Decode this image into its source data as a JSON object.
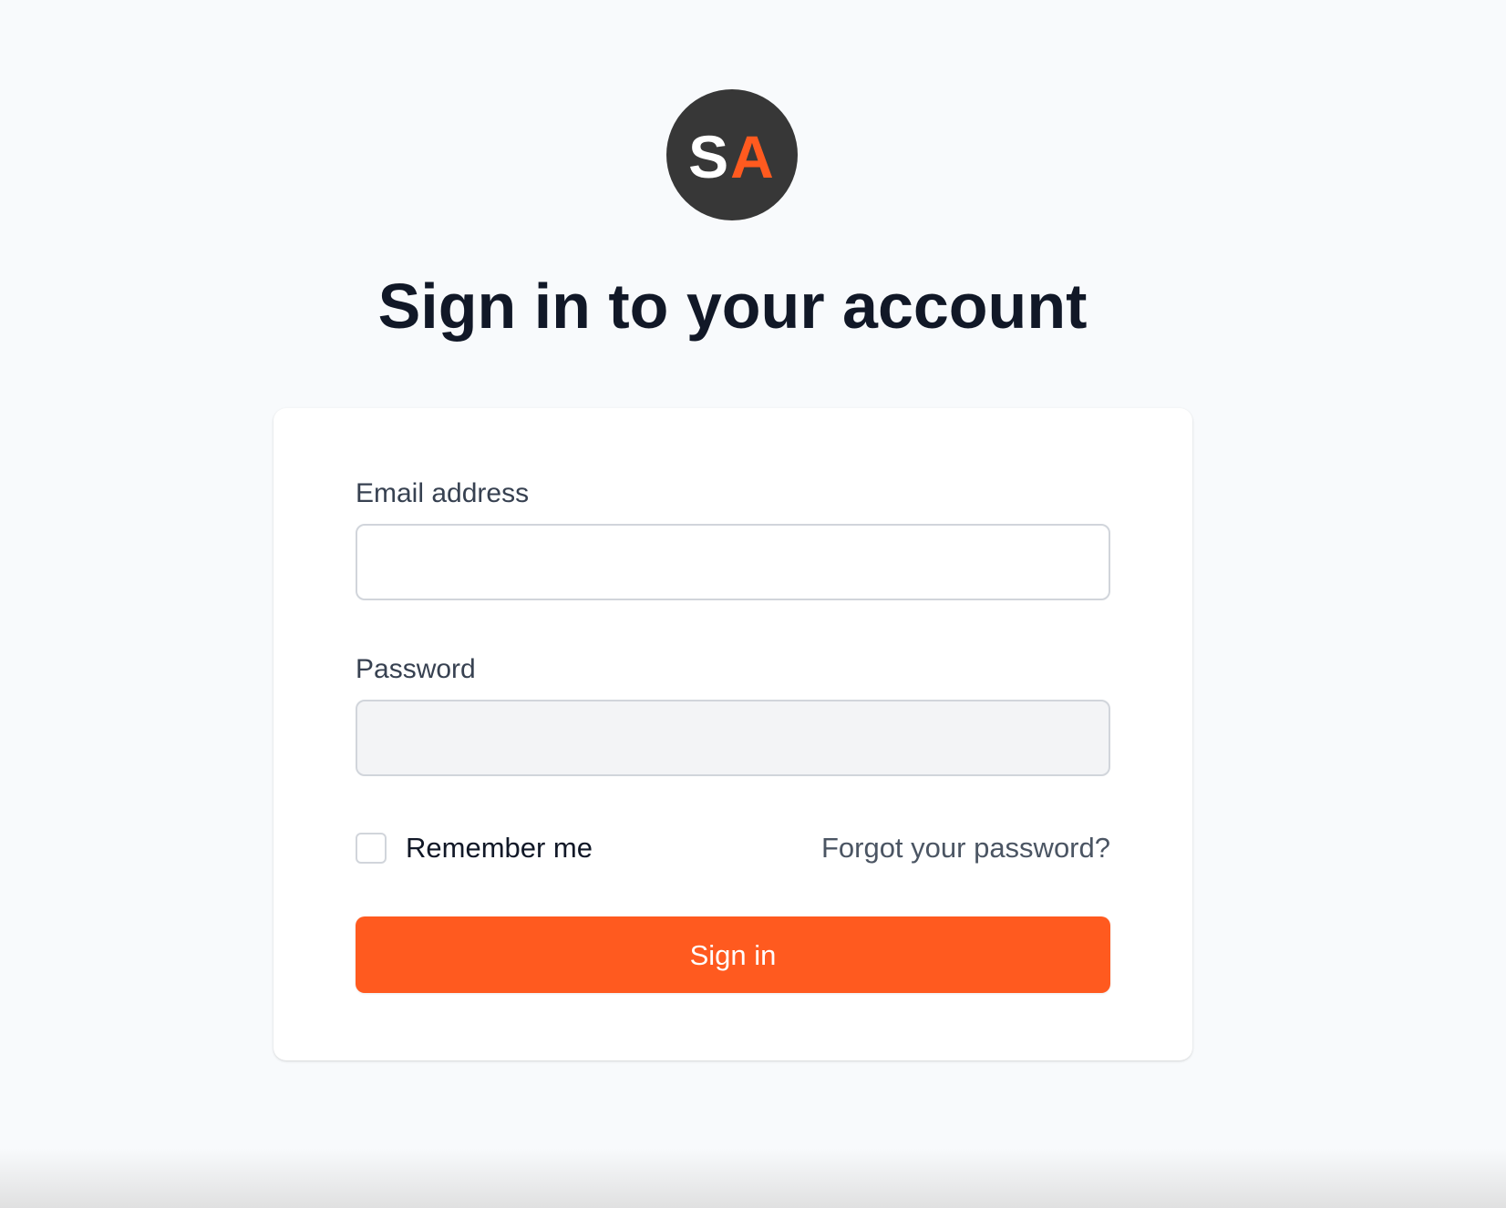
{
  "logo": {
    "letter_1": "S",
    "letter_2": "A",
    "background_color": "#373737",
    "accent_color": "#ff5a1f"
  },
  "title": "Sign in to your account",
  "form": {
    "email": {
      "label": "Email address",
      "value": ""
    },
    "password": {
      "label": "Password",
      "value": ""
    },
    "remember_me": {
      "label": "Remember me",
      "checked": false
    },
    "forgot_password_label": "Forgot your password?",
    "submit_label": "Sign in"
  },
  "colors": {
    "page_background": "#f8fafc",
    "primary_button": "#ff5a1f",
    "heading_text": "#111827"
  }
}
